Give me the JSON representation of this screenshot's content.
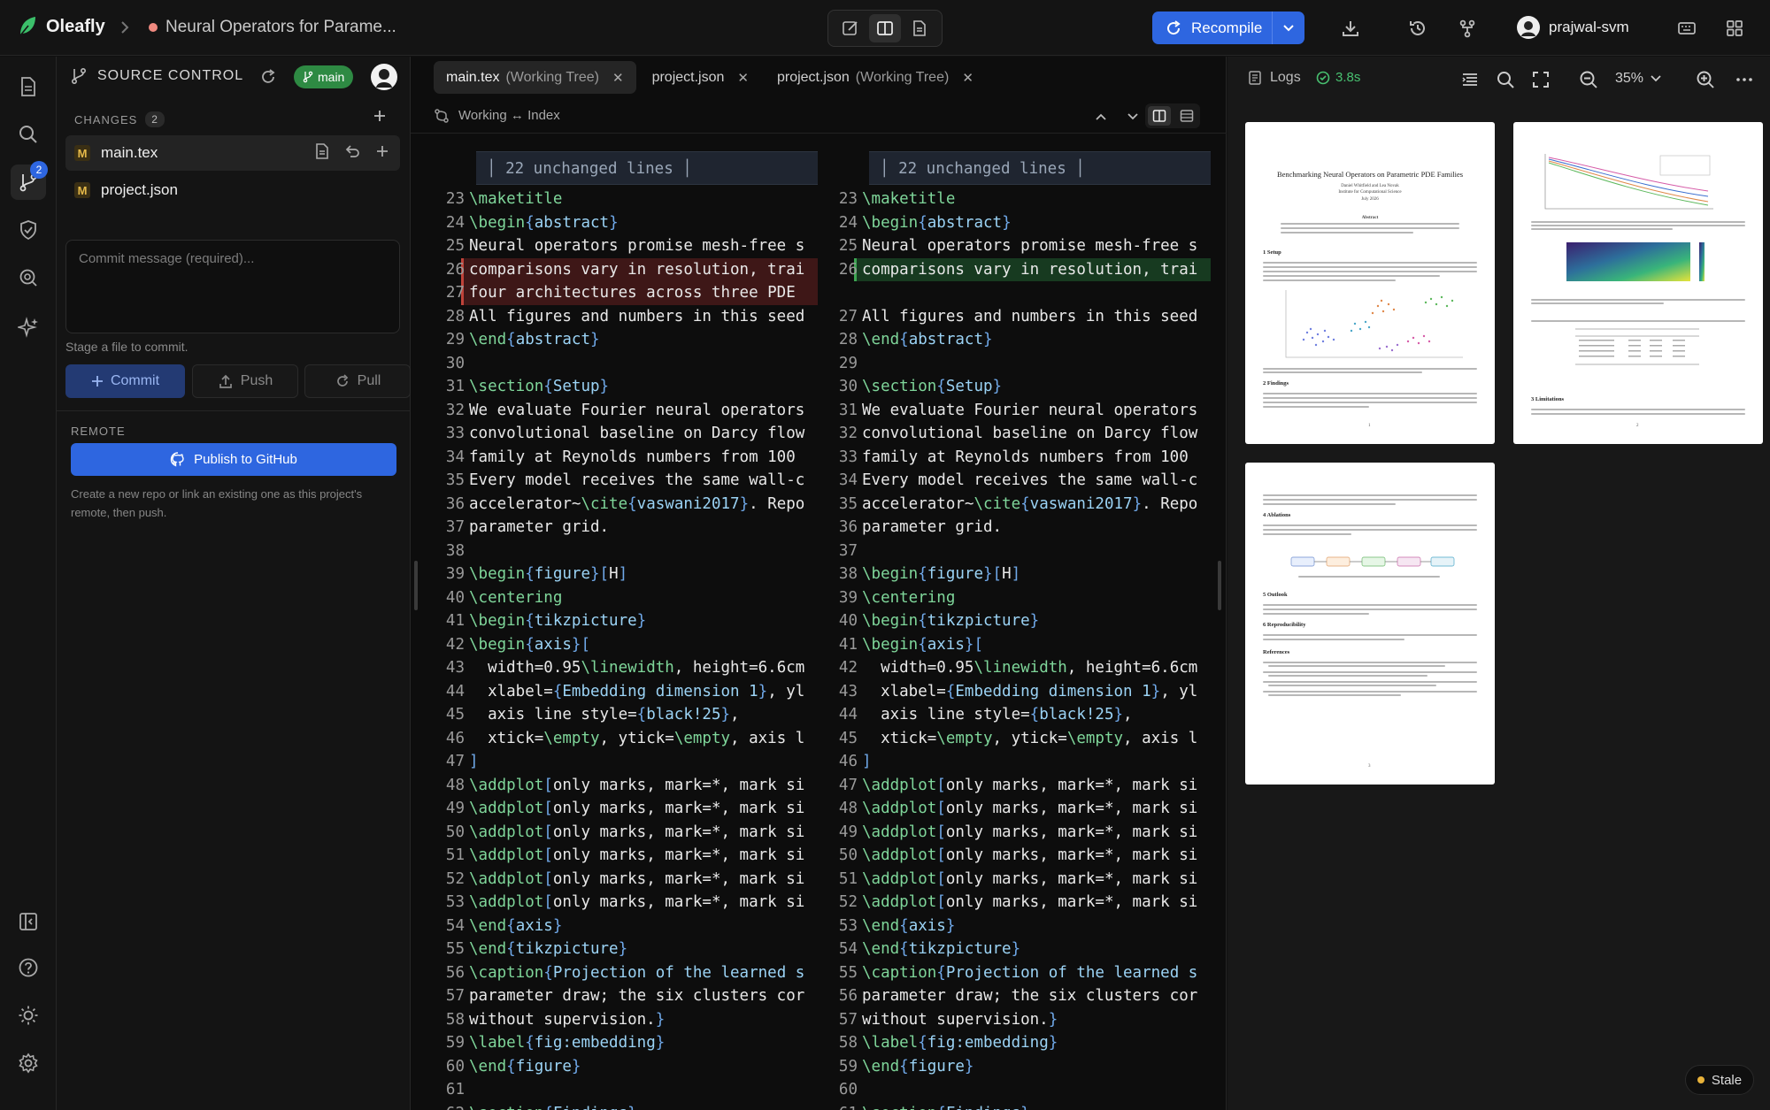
{
  "app": {
    "name": "Oleafly",
    "doc_title": "Neural Operators for Parame..."
  },
  "toolbar": {
    "recompile_label": "Recompile",
    "user_name": "prajwal-svm"
  },
  "rail": {
    "source_control_badge": "2"
  },
  "source_control": {
    "title": "SOURCE CONTROL",
    "branch": "main",
    "changes_label": "CHANGES",
    "changes_count": "2",
    "files": [
      {
        "status": "M",
        "name": "main.tex"
      },
      {
        "status": "M",
        "name": "project.json"
      }
    ],
    "commit_placeholder": "Commit message (required)...",
    "stage_hint": "Stage a file to commit.",
    "commit_label": "Commit",
    "push_label": "Push",
    "pull_label": "Pull",
    "remote_label": "REMOTE",
    "publish_label": "Publish to GitHub",
    "remote_hint": "Create a new repo or link an existing one as this project's remote, then push."
  },
  "editor": {
    "tabs": [
      {
        "name": "main.tex",
        "suffix": "(Working Tree)"
      },
      {
        "name": "project.json",
        "suffix": ""
      },
      {
        "name": "project.json",
        "suffix": "(Working Tree)"
      }
    ],
    "diff_label": "Working ↔ Index",
    "fold_label": "22 unchanged lines",
    "left_lines": [
      {
        "n": "23",
        "t": "\\maketitle",
        "cls": ""
      },
      {
        "n": "24",
        "t": "\\begin{abstract}",
        "cls": ""
      },
      {
        "n": "25",
        "t": "Neural operators promise mesh-free s",
        "cls": ""
      },
      {
        "n": "26",
        "t": "comparisons vary in resolution, trai",
        "cls": "del"
      },
      {
        "n": "27",
        "t": "four architectures across three PDE ",
        "cls": "del"
      },
      {
        "n": "28",
        "t": "All figures and numbers in this seed",
        "cls": ""
      },
      {
        "n": "29",
        "t": "\\end{abstract}",
        "cls": ""
      },
      {
        "n": "30",
        "t": "",
        "cls": ""
      },
      {
        "n": "31",
        "t": "\\section{Setup}",
        "cls": ""
      },
      {
        "n": "32",
        "t": "We evaluate Fourier neural operators",
        "cls": ""
      },
      {
        "n": "33",
        "t": "convolutional baseline on Darcy flow",
        "cls": ""
      },
      {
        "n": "34",
        "t": "family at Reynolds numbers from 100 ",
        "cls": ""
      },
      {
        "n": "35",
        "t": "Every model receives the same wall-c",
        "cls": ""
      },
      {
        "n": "36",
        "t": "accelerator~\\cite{vaswani2017}. Repo",
        "cls": ""
      },
      {
        "n": "37",
        "t": "parameter grid.",
        "cls": ""
      },
      {
        "n": "38",
        "t": "",
        "cls": ""
      },
      {
        "n": "39",
        "t": "\\begin{figure}[H]",
        "cls": ""
      },
      {
        "n": "40",
        "t": "\\centering",
        "cls": ""
      },
      {
        "n": "41",
        "t": "\\begin{tikzpicture}",
        "cls": ""
      },
      {
        "n": "42",
        "t": "\\begin{axis}[",
        "cls": ""
      },
      {
        "n": "43",
        "t": "  width=0.95\\linewidth, height=6.6cm",
        "cls": ""
      },
      {
        "n": "44",
        "t": "  xlabel={Embedding dimension 1}, yl",
        "cls": ""
      },
      {
        "n": "45",
        "t": "  axis line style={black!25},",
        "cls": ""
      },
      {
        "n": "46",
        "t": "  xtick=\\empty, ytick=\\empty, axis l",
        "cls": ""
      },
      {
        "n": "47",
        "t": "]",
        "cls": ""
      },
      {
        "n": "48",
        "t": "\\addplot[only marks, mark=*, mark si",
        "cls": ""
      },
      {
        "n": "49",
        "t": "\\addplot[only marks, mark=*, mark si",
        "cls": ""
      },
      {
        "n": "50",
        "t": "\\addplot[only marks, mark=*, mark si",
        "cls": ""
      },
      {
        "n": "51",
        "t": "\\addplot[only marks, mark=*, mark si",
        "cls": ""
      },
      {
        "n": "52",
        "t": "\\addplot[only marks, mark=*, mark si",
        "cls": ""
      },
      {
        "n": "53",
        "t": "\\addplot[only marks, mark=*, mark si",
        "cls": ""
      },
      {
        "n": "54",
        "t": "\\end{axis}",
        "cls": ""
      },
      {
        "n": "55",
        "t": "\\end{tikzpicture}",
        "cls": ""
      },
      {
        "n": "56",
        "t": "\\caption{Projection of the learned s",
        "cls": ""
      },
      {
        "n": "57",
        "t": "parameter draw; the six clusters cor",
        "cls": ""
      },
      {
        "n": "58",
        "t": "without supervision.}",
        "cls": ""
      },
      {
        "n": "59",
        "t": "\\label{fig:embedding}",
        "cls": ""
      },
      {
        "n": "60",
        "t": "\\end{figure}",
        "cls": ""
      },
      {
        "n": "61",
        "t": "",
        "cls": ""
      },
      {
        "n": "62",
        "t": "\\section{Findings}",
        "cls": ""
      }
    ],
    "right_lines": [
      {
        "n": "23",
        "t": "\\maketitle",
        "cls": ""
      },
      {
        "n": "24",
        "t": "\\begin{abstract}",
        "cls": ""
      },
      {
        "n": "25",
        "t": "Neural operators promise mesh-free s",
        "cls": ""
      },
      {
        "n": "26",
        "t": "comparisons vary in resolution, trai",
        "cls": "add"
      },
      {
        "n": "",
        "t": "",
        "cls": "gap"
      },
      {
        "n": "27",
        "t": "All figures and numbers in this seed",
        "cls": ""
      },
      {
        "n": "28",
        "t": "\\end{abstract}",
        "cls": ""
      },
      {
        "n": "29",
        "t": "",
        "cls": ""
      },
      {
        "n": "30",
        "t": "\\section{Setup}",
        "cls": ""
      },
      {
        "n": "31",
        "t": "We evaluate Fourier neural operators",
        "cls": ""
      },
      {
        "n": "32",
        "t": "convolutional baseline on Darcy flow",
        "cls": ""
      },
      {
        "n": "33",
        "t": "family at Reynolds numbers from 100 ",
        "cls": ""
      },
      {
        "n": "34",
        "t": "Every model receives the same wall-c",
        "cls": ""
      },
      {
        "n": "35",
        "t": "accelerator~\\cite{vaswani2017}. Repo",
        "cls": ""
      },
      {
        "n": "36",
        "t": "parameter grid.",
        "cls": ""
      },
      {
        "n": "37",
        "t": "",
        "cls": ""
      },
      {
        "n": "38",
        "t": "\\begin{figure}[H]",
        "cls": ""
      },
      {
        "n": "39",
        "t": "\\centering",
        "cls": ""
      },
      {
        "n": "40",
        "t": "\\begin{tikzpicture}",
        "cls": ""
      },
      {
        "n": "41",
        "t": "\\begin{axis}[",
        "cls": ""
      },
      {
        "n": "42",
        "t": "  width=0.95\\linewidth, height=6.6cm",
        "cls": ""
      },
      {
        "n": "43",
        "t": "  xlabel={Embedding dimension 1}, yl",
        "cls": ""
      },
      {
        "n": "44",
        "t": "  axis line style={black!25},",
        "cls": ""
      },
      {
        "n": "45",
        "t": "  xtick=\\empty, ytick=\\empty, axis l",
        "cls": ""
      },
      {
        "n": "46",
        "t": "]",
        "cls": ""
      },
      {
        "n": "47",
        "t": "\\addplot[only marks, mark=*, mark si",
        "cls": ""
      },
      {
        "n": "48",
        "t": "\\addplot[only marks, mark=*, mark si",
        "cls": ""
      },
      {
        "n": "49",
        "t": "\\addplot[only marks, mark=*, mark si",
        "cls": ""
      },
      {
        "n": "50",
        "t": "\\addplot[only marks, mark=*, mark si",
        "cls": ""
      },
      {
        "n": "51",
        "t": "\\addplot[only marks, mark=*, mark si",
        "cls": ""
      },
      {
        "n": "52",
        "t": "\\addplot[only marks, mark=*, mark si",
        "cls": ""
      },
      {
        "n": "53",
        "t": "\\end{axis}",
        "cls": ""
      },
      {
        "n": "54",
        "t": "\\end{tikzpicture}",
        "cls": ""
      },
      {
        "n": "55",
        "t": "\\caption{Projection of the learned s",
        "cls": ""
      },
      {
        "n": "56",
        "t": "parameter draw; the six clusters cor",
        "cls": ""
      },
      {
        "n": "57",
        "t": "without supervision.}",
        "cls": ""
      },
      {
        "n": "58",
        "t": "\\label{fig:embedding}",
        "cls": ""
      },
      {
        "n": "59",
        "t": "\\end{figure}",
        "cls": ""
      },
      {
        "n": "60",
        "t": "",
        "cls": ""
      },
      {
        "n": "61",
        "t": "\\section{Findings}",
        "cls": ""
      }
    ]
  },
  "preview": {
    "logs_label": "Logs",
    "compile_time": "3.8s",
    "zoom": "35%",
    "status": "Stale",
    "page1": {
      "title": "Benchmarking Neural Operators on Parametric PDE Families",
      "authors": "Daniel Whitfield and Lea Novak",
      "affil": "Institute for Computational Science",
      "date": "July 2026",
      "abstract": "Abstract",
      "s1": "1   Setup",
      "s2": "2   Findings",
      "num": "1"
    },
    "page2": {
      "s3": "3   Limitations",
      "num": "2"
    },
    "page3": {
      "s4": "4   Ablations",
      "s5": "5   Outlook",
      "s6": "6   Reproducibility",
      "refs": "References",
      "num": "3"
    }
  }
}
